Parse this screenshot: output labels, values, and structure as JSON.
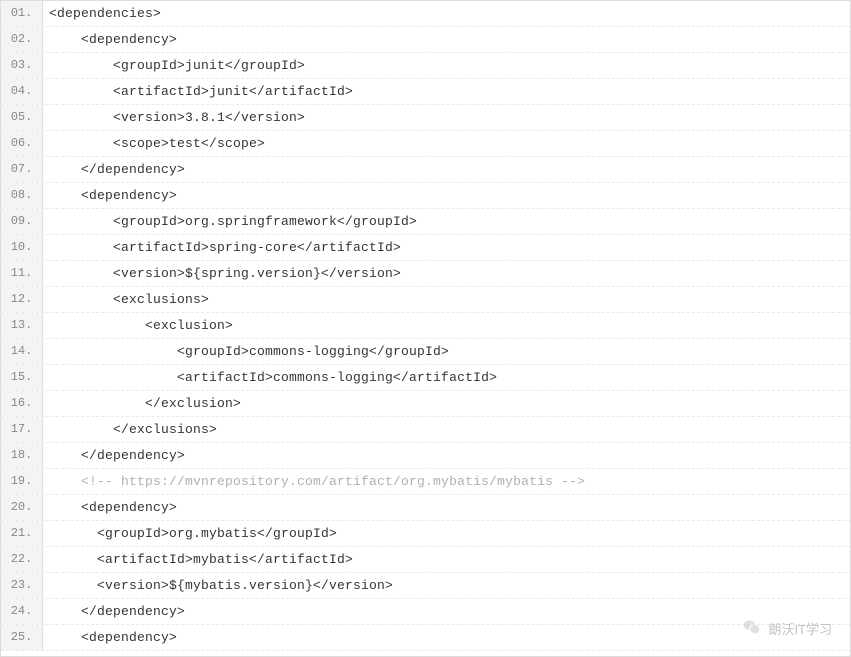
{
  "watermark": {
    "text": "朗沃IT学习"
  },
  "lines": [
    {
      "num": "01.",
      "indent": 0,
      "text": "<dependencies>"
    },
    {
      "num": "02.",
      "indent": 1,
      "text": "<dependency>"
    },
    {
      "num": "03.",
      "indent": 2,
      "text": "<groupId>junit</groupId>"
    },
    {
      "num": "04.",
      "indent": 2,
      "text": "<artifactId>junit</artifactId>"
    },
    {
      "num": "05.",
      "indent": 2,
      "text": "<version>3.8.1</version>"
    },
    {
      "num": "06.",
      "indent": 2,
      "text": "<scope>test</scope>"
    },
    {
      "num": "07.",
      "indent": 1,
      "text": "</dependency>"
    },
    {
      "num": "08.",
      "indent": 1,
      "text": "<dependency>"
    },
    {
      "num": "09.",
      "indent": 2,
      "text": "<groupId>org.springframework</groupId>"
    },
    {
      "num": "10.",
      "indent": 2,
      "text": "<artifactId>spring-core</artifactId>"
    },
    {
      "num": "11.",
      "indent": 2,
      "text": "<version>${spring.version}</version>"
    },
    {
      "num": "12.",
      "indent": 2,
      "text": "<exclusions>"
    },
    {
      "num": "13.",
      "indent": 3,
      "text": "<exclusion>"
    },
    {
      "num": "14.",
      "indent": 4,
      "text": "<groupId>commons-logging</groupId>"
    },
    {
      "num": "15.",
      "indent": 4,
      "text": "<artifactId>commons-logging</artifactId>"
    },
    {
      "num": "16.",
      "indent": 3,
      "text": "</exclusion>"
    },
    {
      "num": "17.",
      "indent": 2,
      "text": "</exclusions>"
    },
    {
      "num": "18.",
      "indent": 1,
      "text": "</dependency>"
    },
    {
      "num": "19.",
      "indent": 1,
      "text": "<!-- https://mvnrepository.com/artifact/org.mybatis/mybatis -->",
      "comment": true
    },
    {
      "num": "20.",
      "indent": 1,
      "text": "<dependency>"
    },
    {
      "num": "21.",
      "indent": 1,
      "text": "  <groupId>org.mybatis</groupId>"
    },
    {
      "num": "22.",
      "indent": 1,
      "text": "  <artifactId>mybatis</artifactId>"
    },
    {
      "num": "23.",
      "indent": 1,
      "text": "  <version>${mybatis.version}</version>"
    },
    {
      "num": "24.",
      "indent": 1,
      "text": "</dependency>"
    },
    {
      "num": "25.",
      "indent": 1,
      "text": "<dependency>"
    }
  ]
}
